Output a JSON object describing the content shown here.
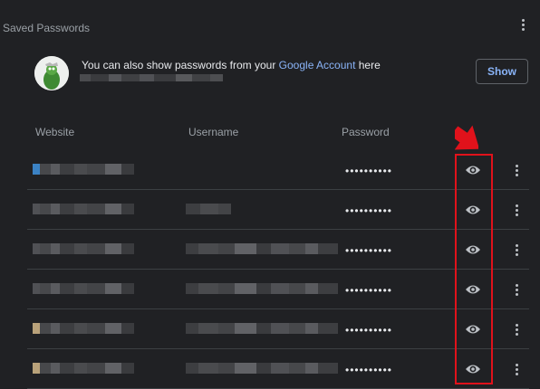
{
  "header": {
    "title": "Saved Passwords"
  },
  "account": {
    "message_prefix": "You can also show passwords from your ",
    "link_text": "Google Account",
    "message_suffix": " here",
    "show_button": "Show"
  },
  "columns": {
    "website": "Website",
    "username": "Username",
    "password": "Password"
  },
  "rows": [
    {
      "password": "••••••••••"
    },
    {
      "password": "••••••••••"
    },
    {
      "password": "••••••••••"
    },
    {
      "password": "••••••••••"
    },
    {
      "password": "••••••••••"
    },
    {
      "password": "••••••••••"
    }
  ],
  "colors": {
    "accent": "#8ab4f8",
    "highlight": "#e0121b",
    "background": "#202124"
  },
  "icons": {
    "row_action": "eye-icon",
    "more": "kebab-menu-icon"
  }
}
